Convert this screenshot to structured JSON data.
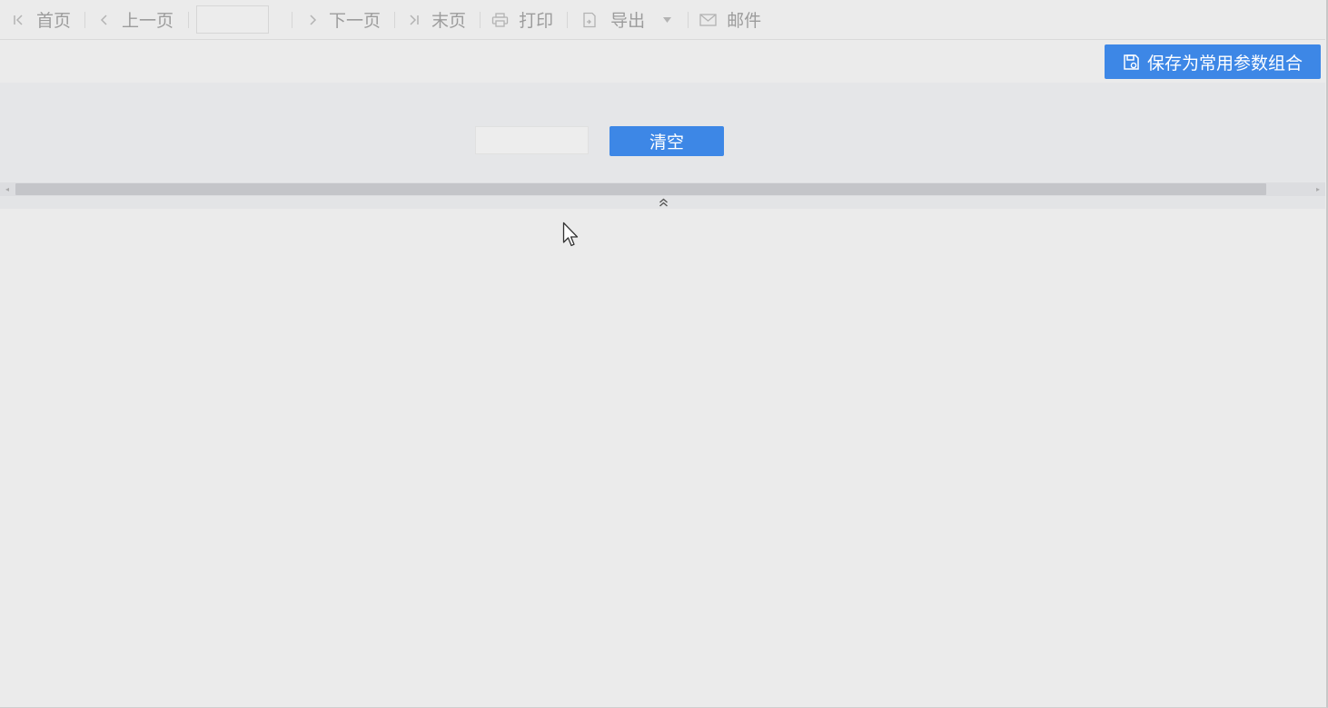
{
  "toolbar": {
    "first_label": "首页",
    "prev_label": "上一页",
    "page_value": "",
    "next_label": "下一页",
    "last_label": "末页",
    "print_label": "打印",
    "export_label": "导出",
    "mail_label": "邮件"
  },
  "actions": {
    "save_params_label": "保存为常用参数组合"
  },
  "params": {
    "input_value": "",
    "clear_label": "清空"
  },
  "colors": {
    "accent": "#3d87e6",
    "background": "#ebebeb",
    "param_area": "#e5e6e8",
    "disabled_text": "#9c9c9c"
  },
  "icons": {
    "first": "first-page-icon",
    "prev": "chevron-left-icon",
    "next": "chevron-right-icon",
    "last": "last-page-icon",
    "print": "printer-icon",
    "export": "export-icon",
    "dropdown": "caret-down-icon",
    "mail": "mail-icon",
    "save": "save-icon",
    "collapse": "double-chevron-up-icon"
  }
}
